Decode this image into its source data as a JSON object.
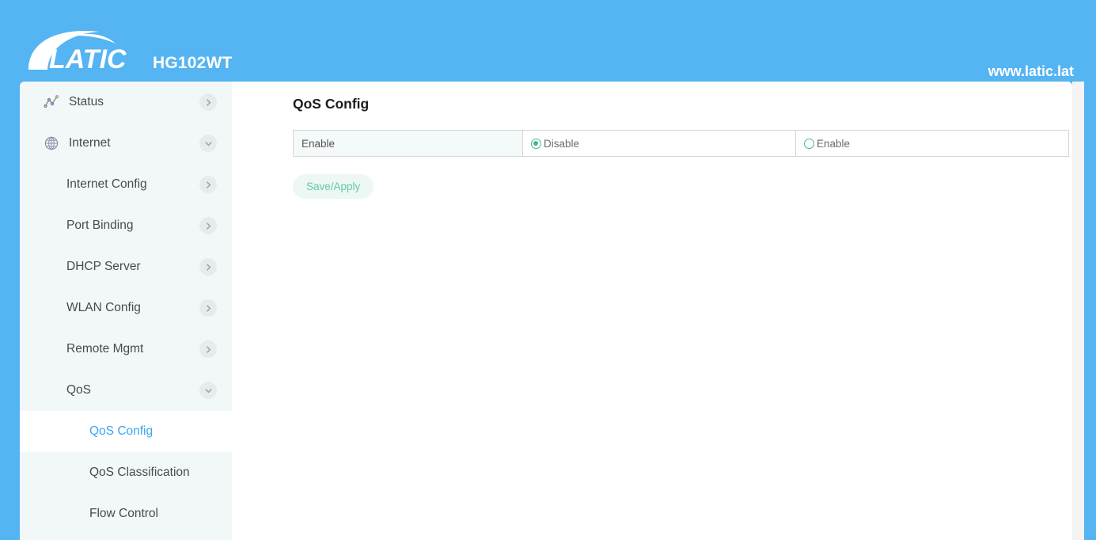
{
  "header": {
    "brand_name": "LATIC",
    "device_model": "HG102WT",
    "site_url": "www.latic.lat",
    "background_color": "#55b4f2"
  },
  "sidebar": {
    "items": [
      {
        "label": "Status",
        "icon": "analytics-icon",
        "level": "top",
        "chevron": "right",
        "active": false
      },
      {
        "label": "Internet",
        "icon": "globe-icon",
        "level": "top",
        "chevron": "down",
        "active": false
      },
      {
        "label": "Internet Config",
        "icon": null,
        "level": "sub",
        "chevron": "right",
        "active": false
      },
      {
        "label": "Port Binding",
        "icon": null,
        "level": "sub",
        "chevron": "right",
        "active": false
      },
      {
        "label": "DHCP Server",
        "icon": null,
        "level": "sub",
        "chevron": "right",
        "active": false
      },
      {
        "label": "WLAN Config",
        "icon": null,
        "level": "sub",
        "chevron": "right",
        "active": false
      },
      {
        "label": "Remote Mgmt",
        "icon": null,
        "level": "sub",
        "chevron": "right",
        "active": false
      },
      {
        "label": "QoS",
        "icon": null,
        "level": "sub",
        "chevron": "down",
        "active": false
      },
      {
        "label": "QoS Config",
        "icon": null,
        "level": "sub2",
        "chevron": null,
        "active": true
      },
      {
        "label": "QoS Classification",
        "icon": null,
        "level": "sub2",
        "chevron": null,
        "active": false
      },
      {
        "label": "Flow Control",
        "icon": null,
        "level": "sub2",
        "chevron": null,
        "active": false
      }
    ],
    "active_color": "#38a6f0",
    "background_color": "#f2f8f8"
  },
  "main": {
    "page_title": "QoS Config",
    "config_rows": [
      {
        "label": "Enable",
        "options": [
          {
            "text": "Disable",
            "selected": true
          },
          {
            "text": "Enable",
            "selected": false
          }
        ]
      }
    ],
    "save_label": "Save/Apply",
    "accent_green": "#46b699"
  }
}
